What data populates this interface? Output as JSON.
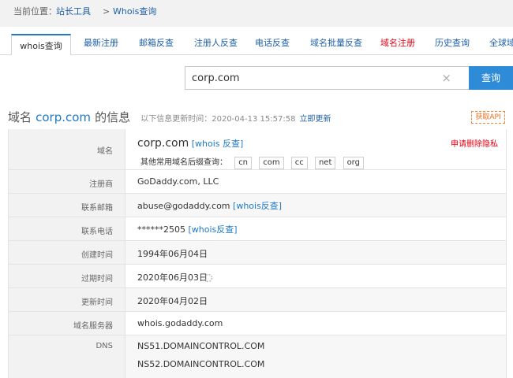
{
  "breadcrumb": {
    "label": "当前位置：",
    "home": "站长工具",
    "sep": ">",
    "current": "Whois查询"
  },
  "tabs": [
    {
      "label": "whois查询",
      "active": true
    },
    {
      "label": "最新注册"
    },
    {
      "label": "邮箱反查"
    },
    {
      "label": "注册人反查"
    },
    {
      "label": "电话反查"
    },
    {
      "label": "域名批量反查"
    },
    {
      "label": "域名注册",
      "highlight": true
    },
    {
      "label": "历史查询"
    },
    {
      "label": "全球域"
    }
  ],
  "search": {
    "value": "corp.com",
    "clear": "×",
    "button": "查询"
  },
  "info": {
    "title_prefix": "域名",
    "domain": "corp.com",
    "title_suffix": "的信息",
    "update_text": "以下信息更新时间：2020-04-13 15:57:58",
    "update_link": "立即更新",
    "api_button": "获取API"
  },
  "rows": {
    "domain": {
      "label": "域名",
      "value": "corp.com",
      "link": "[whois 反查]",
      "privacy": "申请删除隐私",
      "suffix_label": "其他常用域名后缀查询：",
      "suffixes": [
        "cn",
        "com",
        "cc",
        "net",
        "org"
      ]
    },
    "registrar": {
      "label": "注册商",
      "value": "GoDaddy.com, LLC"
    },
    "email": {
      "label": "联系邮箱",
      "value": "abuse@godaddy.com",
      "link": "[whois反查]"
    },
    "phone": {
      "label": "联系电话",
      "value": "******2505",
      "link": "[whois反查]"
    },
    "created": {
      "label": "创建时间",
      "value": "1994年06月04日"
    },
    "expires": {
      "label": "过期时间",
      "value": "2020年06月03日"
    },
    "updated": {
      "label": "更新时间",
      "value": "2020年04月02日"
    },
    "nameserver": {
      "label": "域名服务器",
      "value": "whois.godaddy.com"
    },
    "dns": {
      "label": "DNS",
      "values": [
        "NS51.DOMAINCONTROL.COM",
        "NS52.DOMAINCONTROL.COM"
      ]
    }
  },
  "icons": {
    "refresh": "refresh-icon",
    "clear": "close-icon"
  },
  "colors": {
    "link": "#1e79c7",
    "button": "#2e8bd8",
    "highlight": "#e60012",
    "api": "#f06e1e"
  }
}
